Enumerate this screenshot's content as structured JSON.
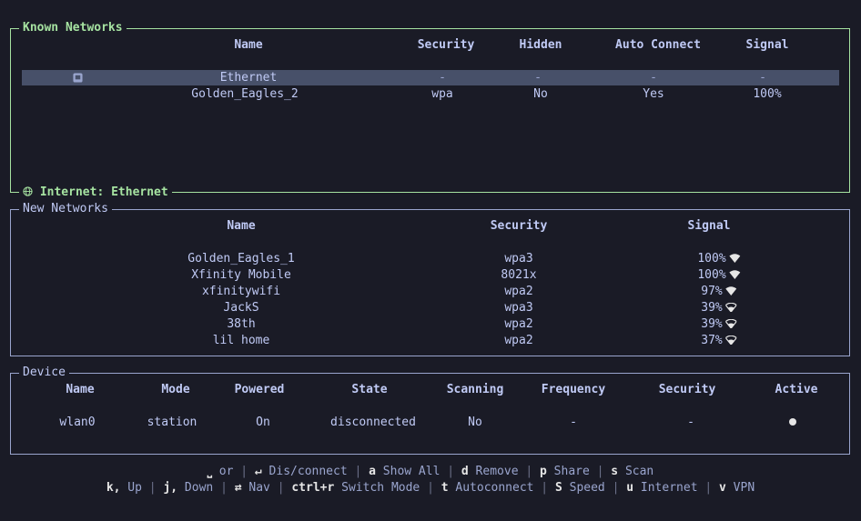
{
  "known": {
    "title": "Known Networks",
    "bottom_label": "Internet: Ethernet",
    "headers": [
      "Name",
      "Security",
      "Hidden",
      "Auto Connect",
      "Signal"
    ],
    "rows": [
      {
        "name": "Ethernet",
        "security": "-",
        "hidden": "-",
        "auto": "-",
        "signal": "-",
        "selected": true
      },
      {
        "name": "Golden_Eagles_2",
        "security": "wpa",
        "hidden": "No",
        "auto": "Yes",
        "signal": "100%",
        "selected": false
      }
    ]
  },
  "new_networks": {
    "title": "New Networks",
    "headers": [
      "Name",
      "Security",
      "Signal"
    ],
    "rows": [
      {
        "name": "Golden_Eagles_1",
        "security": "wpa3",
        "signal": "100%",
        "bars": 4
      },
      {
        "name": "Xfinity Mobile",
        "security": "8021x",
        "signal": "100%",
        "bars": 4
      },
      {
        "name": "xfinitywifi",
        "security": "wpa2",
        "signal": "97%",
        "bars": 4
      },
      {
        "name": "JackS",
        "security": "wpa3",
        "signal": "39%",
        "bars": 2
      },
      {
        "name": "38th",
        "security": "wpa2",
        "signal": "39%",
        "bars": 2
      },
      {
        "name": "lil home",
        "security": "wpa2",
        "signal": "37%",
        "bars": 2
      }
    ]
  },
  "device": {
    "title": "Device",
    "headers": [
      "Name",
      "Mode",
      "Powered",
      "State",
      "Scanning",
      "Frequency",
      "Security",
      "Active"
    ],
    "row": [
      "wlan0",
      "station",
      "On",
      "disconnected",
      "No",
      "-",
      "-"
    ]
  },
  "footer": {
    "line1": [
      {
        "key": "⎵",
        "text": " or "
      },
      {
        "key": "↵",
        "text": " Dis/connect"
      },
      {
        "key": "a",
        "text": " Show All"
      },
      {
        "key": "d",
        "text": " Remove"
      },
      {
        "key": "p",
        "text": " Share"
      },
      {
        "key": "s",
        "text": " Scan"
      }
    ],
    "line2": [
      {
        "key": "k,",
        "text": "  Up"
      },
      {
        "key": "j,",
        "text": "  Down"
      },
      {
        "key": "⇄",
        "text": " Nav"
      },
      {
        "key": "ctrl+r",
        "text": " Switch Mode"
      },
      {
        "key": "t",
        "text": " Autoconnect"
      },
      {
        "key": "S",
        "text": " Speed"
      },
      {
        "key": "u",
        "text": " Internet"
      },
      {
        "key": "v",
        "text": " VPN"
      }
    ]
  },
  "colors": {
    "background": "#1a1b26",
    "known_border": "#a6e3a1",
    "selection": "#475069"
  }
}
